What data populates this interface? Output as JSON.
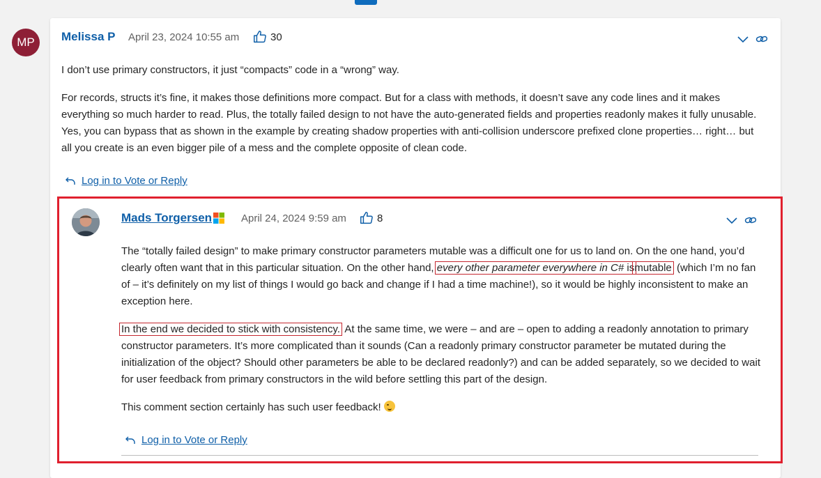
{
  "comment1": {
    "initials": "MP",
    "author": "Melissa P",
    "timestamp": "April 23, 2024 10:55 am",
    "votes": "30",
    "paragraphs": [
      "I don’t use primary constructors, it just “compacts” code in a “wrong” way.",
      "For records, structs it’s fine, it makes those definitions more compact. But for a class with methods, it doesn’t save any code lines and it makes everything so much harder to read. Plus, the totally failed design to not have the auto-generated fields and properties readonly makes it fully unusable. Yes, you can bypass that as shown in the example by creating shadow properties with anti-collision underscore prefixed clone properties… right… but all you create is an even bigger pile of a mess and the complete opposite of clean code."
    ],
    "reply_link": "Log in to Vote or Reply"
  },
  "comment2": {
    "author": "Mads Torgersen",
    "timestamp": "April 24, 2024 9:59 am",
    "votes": "8",
    "p1_a": "The “totally failed design” to make primary constructor parameters mutable was a difficult one for us to land on. On the one hand, you’d clearly often want that in this particular situation. On the other hand, ",
    "p1_em": "every other parameter everywhere in C#",
    "p1_b": " is",
    "p1_c": "mutable",
    "p1_d": " (which I’m no fan of – it’s definitely on my list of things I would go back and change if I had a time machine!), so it would be highly inconsistent to make an exception here.",
    "p2_a": "In the end we decided to stick with consistency.",
    "p2_b": " At the same time, we were – and are – open to adding a readonly annotation to primary constructor parameters. It’s more complicated than it sounds (Can a readonly primary constructor parameter be mutated during the initialization of the object? Should other parameters be able to be declared readonly?) and can be added separately, so we decided to wait for user feedback from primary constructors in the wild before settling this part of the design.",
    "p3": "This comment section certainly has such user feedback! ",
    "reply_link": "Log in to Vote or Reply"
  },
  "colors": {
    "author_link": "#0f5fa8",
    "avatar_bg": "#8e1f36",
    "highlight": "#e0202e"
  },
  "icons": [
    "thumbs-up-icon",
    "chevron-down-icon",
    "link-icon",
    "reply-arrow-icon",
    "microsoft-logo-icon",
    "winking-emoji-icon"
  ]
}
